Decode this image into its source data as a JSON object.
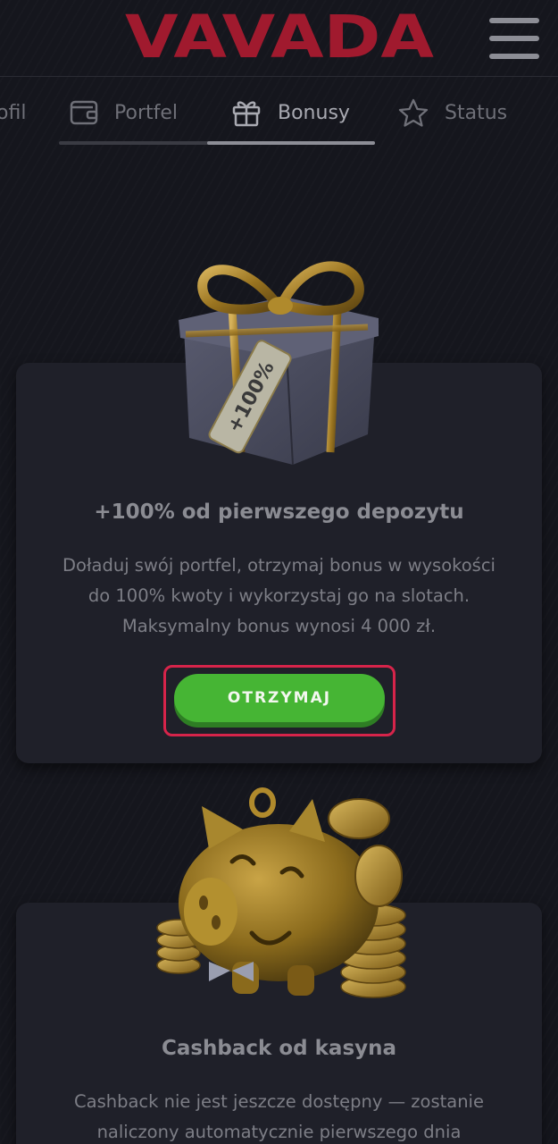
{
  "header": {
    "logo_text": "VAVADA",
    "menu_icon": "hamburger-menu-icon"
  },
  "tabs": [
    {
      "label": "ofil",
      "icon": "user-icon",
      "active": false
    },
    {
      "label": "Portfel",
      "icon": "wallet-icon",
      "active": false
    },
    {
      "label": "Bonusy",
      "icon": "gift-icon",
      "active": true
    },
    {
      "label": "Status",
      "icon": "star-icon",
      "active": false
    }
  ],
  "bonus_deposit": {
    "tag_text": "+100%",
    "title": "+100% od pierwszego depozytu",
    "description": "Doładuj swój portfel, otrzymaj bonus w wysokości do 100% kwoty i wykorzystaj go na slotach. Maksymalny bonus wynosi 4 000 zł.",
    "button_label": "OTRZYMAJ"
  },
  "bonus_cashback": {
    "title": "Cashback od kasyna",
    "description": "Cashback nie jest jeszcze dostępny — zostanie naliczony automatycznie pierwszego dnia"
  },
  "colors": {
    "background": "#15161d",
    "card": "#1f2029",
    "logo_red": "#a01a2e",
    "button_green": "#46b534",
    "highlight_red": "#d6244a",
    "gold": "#b08a2c"
  }
}
